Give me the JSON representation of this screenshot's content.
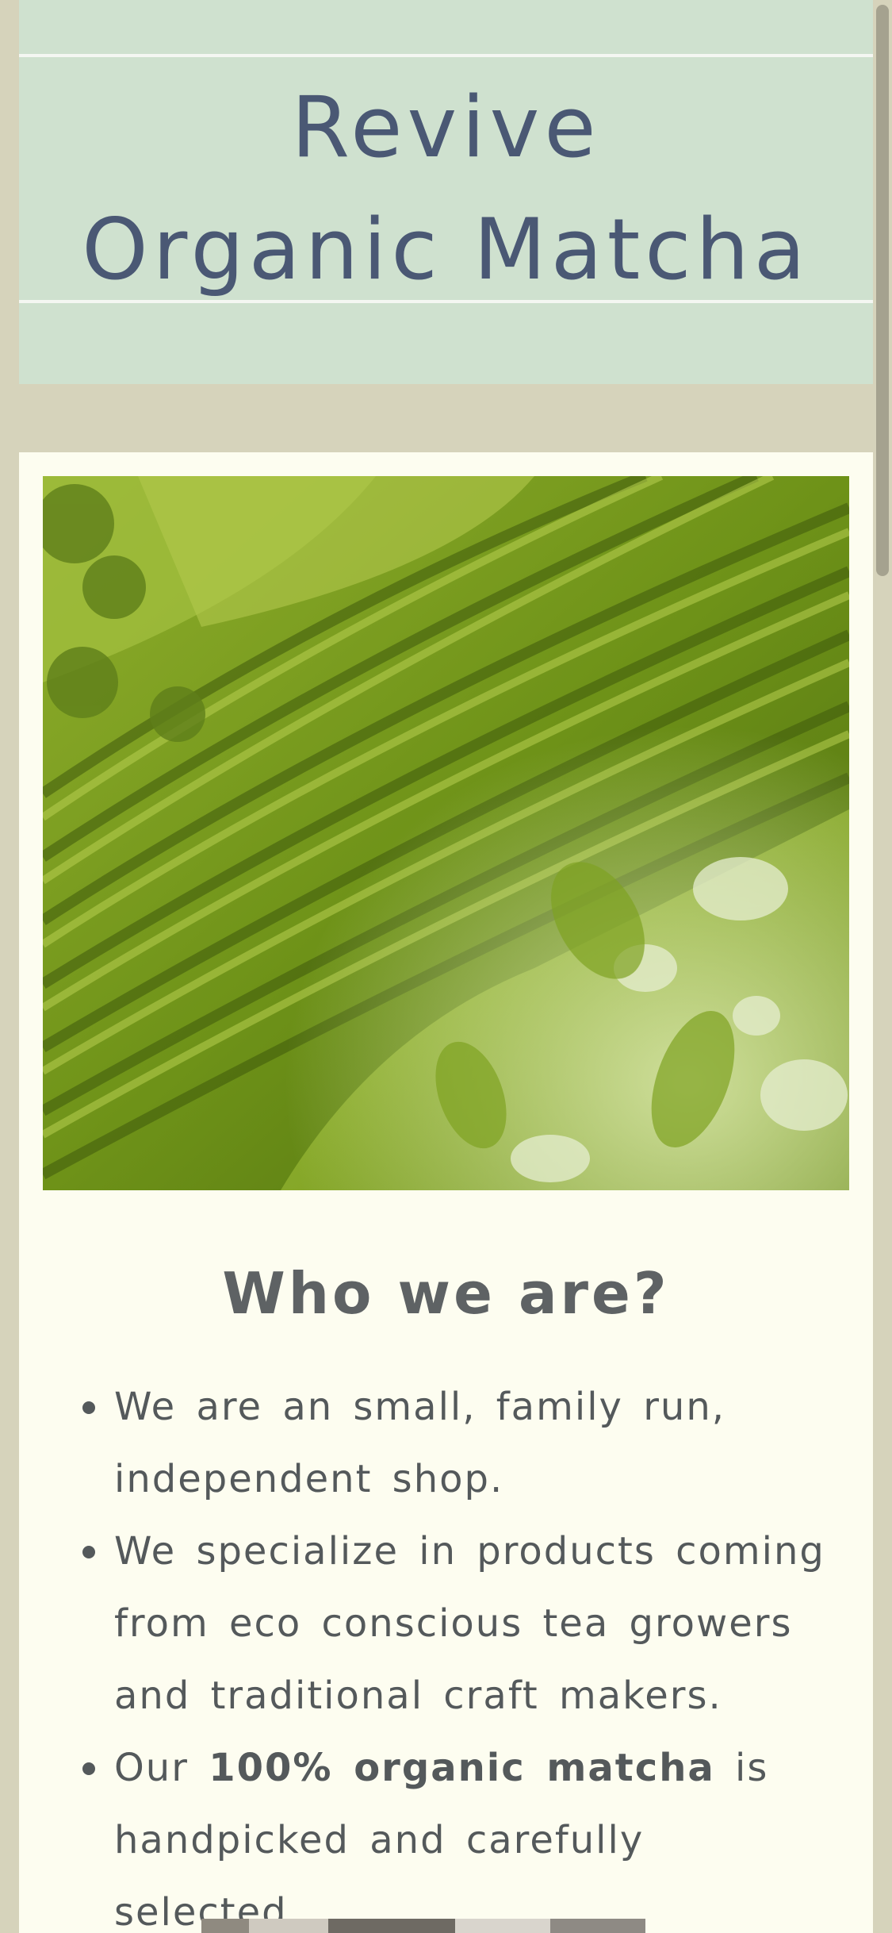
{
  "header": {
    "title_line1": "Revive",
    "title_line2": "Organic Matcha"
  },
  "hero_image": {
    "icon": "tea-plantation-photo"
  },
  "about": {
    "heading": "Who we are?",
    "items": [
      {
        "before": "We are an small, family run, independent shop.",
        "bold": "",
        "after": ""
      },
      {
        "before": "We specialize in products coming from eco conscious tea growers and traditional craft makers.",
        "bold": "",
        "after": ""
      },
      {
        "before": "Our ",
        "bold": "100% organic matcha",
        "after": " is handpicked and carefully selected."
      }
    ]
  },
  "colors": {
    "page_bg": "#d6d3bb",
    "header_bg": "#cfe1cf",
    "title": "#4a5874",
    "card_bg": "#fdfdf0",
    "heading": "#5e6264",
    "body_text": "#54595b"
  }
}
